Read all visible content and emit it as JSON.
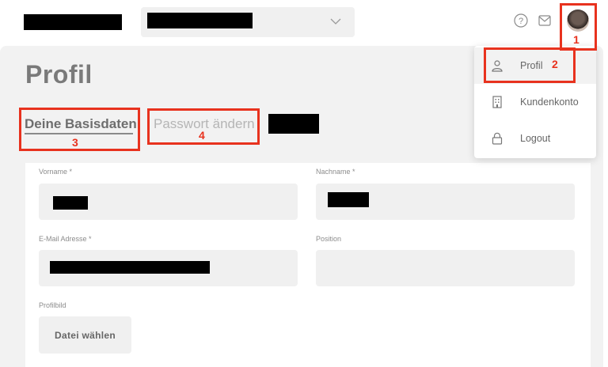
{
  "page": {
    "title": "Profil"
  },
  "tabs": [
    {
      "label": "Deine Basisdaten",
      "active": true
    },
    {
      "label": "Passwort ändern",
      "active": false
    }
  ],
  "form": {
    "vorname_label": "Vorname *",
    "nachname_label": "Nachname *",
    "email_label": "E-Mail Adresse *",
    "position_label": "Position",
    "profilbild_label": "Profilbild",
    "file_button_label": "Datei wählen"
  },
  "user_menu": {
    "items": [
      {
        "label": "Profil",
        "icon": "person-icon"
      },
      {
        "label": "Kundenkonto",
        "icon": "building-icon"
      },
      {
        "label": "Logout",
        "icon": "lock-icon"
      }
    ]
  },
  "header": {
    "icons": [
      "help-icon",
      "mail-icon",
      "avatar"
    ]
  },
  "annotations": {
    "numbers": [
      "1",
      "2",
      "3",
      "4"
    ],
    "color": "#e8321e"
  }
}
